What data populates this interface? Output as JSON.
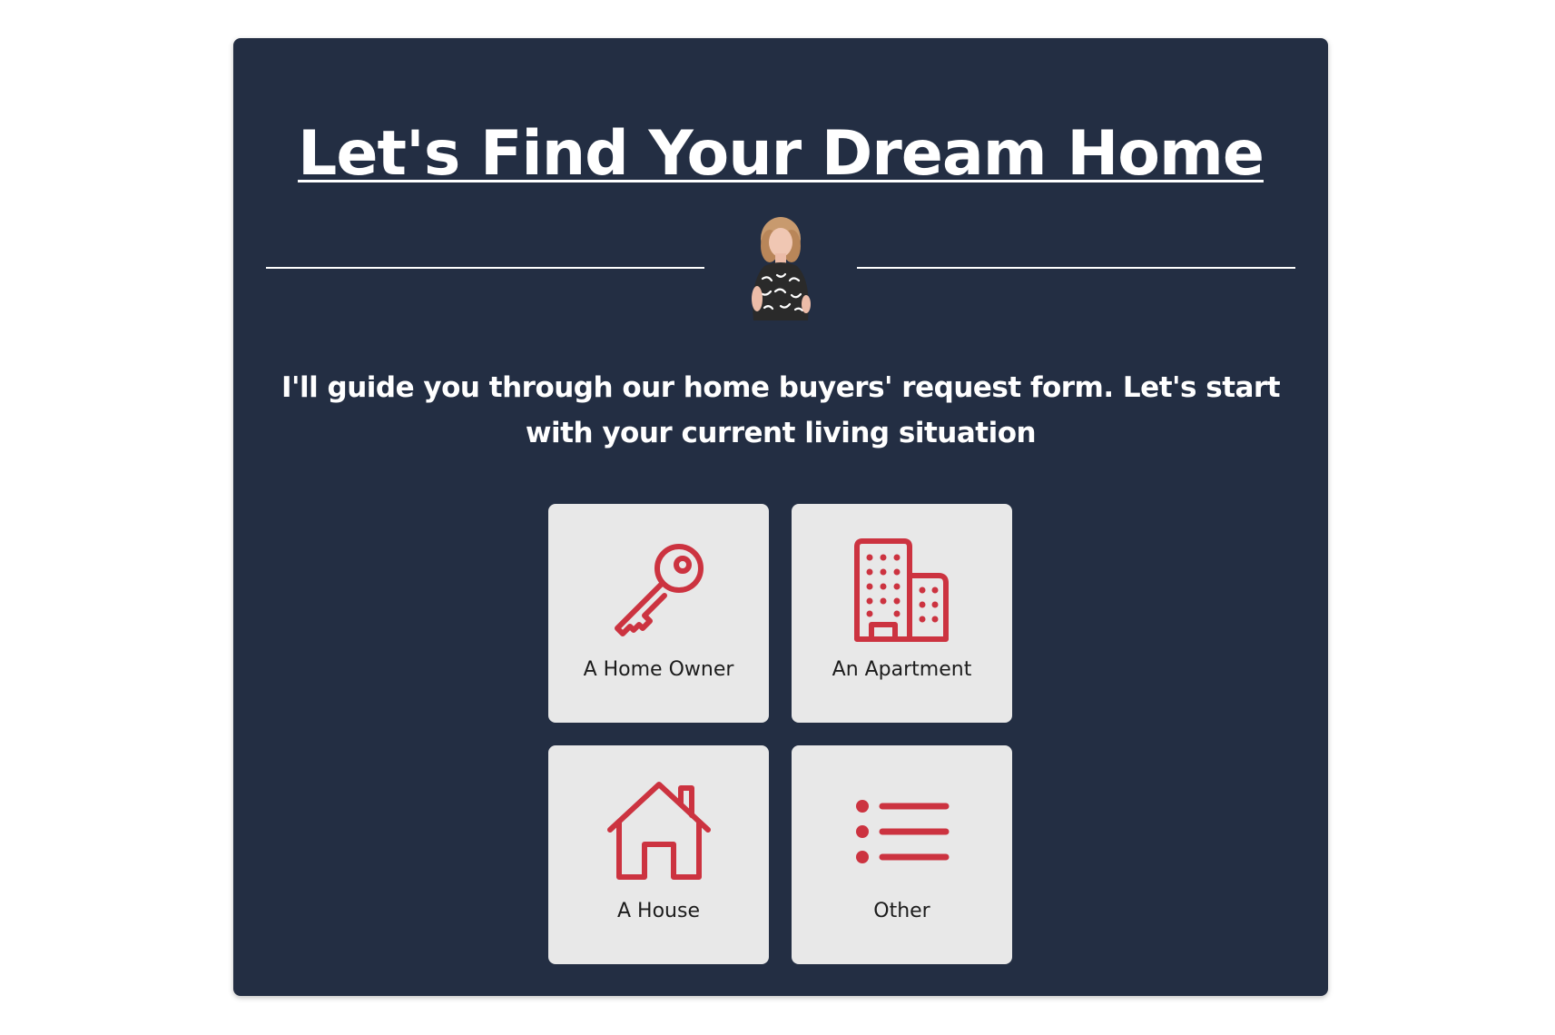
{
  "header": {
    "title": "Let's Find Your Dream Home"
  },
  "intro": {
    "text": "I'll guide you through our home buyers' request form. Let's start with your current living situation"
  },
  "options": [
    {
      "label": "A Home Owner",
      "icon": "key-icon"
    },
    {
      "label": "An Apartment",
      "icon": "building-icon"
    },
    {
      "label": "A House",
      "icon": "house-icon"
    },
    {
      "label": "Other",
      "icon": "list-icon"
    }
  ],
  "colors": {
    "card_background": "#232e43",
    "option_background": "#e8e8e8",
    "icon_accent": "#cc3340",
    "text_light": "#ffffff"
  }
}
